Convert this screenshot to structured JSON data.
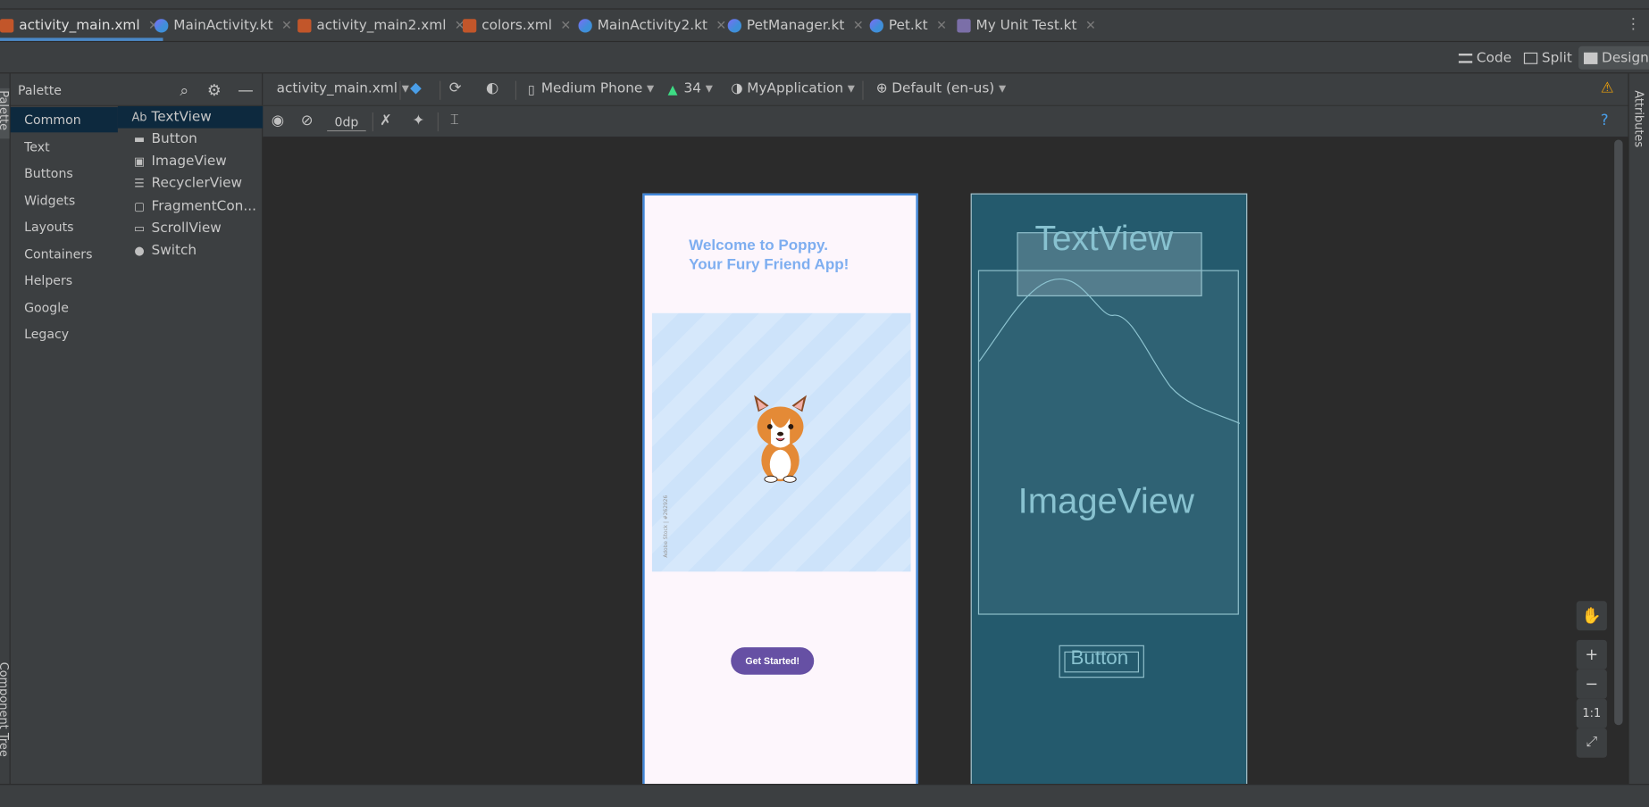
{
  "tabs": [
    {
      "label": "activity_main.xml",
      "type": "xml",
      "active": true
    },
    {
      "label": "MainActivity.kt",
      "type": "kt"
    },
    {
      "label": "activity_main2.xml",
      "type": "xml"
    },
    {
      "label": "colors.xml",
      "type": "xml"
    },
    {
      "label": "MainActivity2.kt",
      "type": "kt"
    },
    {
      "label": "PetManager.kt",
      "type": "kt"
    },
    {
      "label": "Pet.kt",
      "type": "kt"
    },
    {
      "label": "My Unit Test.kt",
      "type": "test"
    }
  ],
  "view_modes": {
    "code": "Code",
    "split": "Split",
    "design": "Design"
  },
  "palette": {
    "title": "Palette",
    "categories": [
      "Common",
      "Text",
      "Buttons",
      "Widgets",
      "Layouts",
      "Containers",
      "Helpers",
      "Google",
      "Legacy"
    ],
    "widgets": [
      {
        "label": "TextView",
        "icon": "Ab"
      },
      {
        "label": "Button",
        "icon": "▬"
      },
      {
        "label": "ImageView",
        "icon": "▣"
      },
      {
        "label": "RecyclerView",
        "icon": "☰"
      },
      {
        "label": "FragmentCon...",
        "icon": "▢"
      },
      {
        "label": "ScrollView",
        "icon": "▭"
      },
      {
        "label": "Switch",
        "icon": "●"
      }
    ]
  },
  "toolbar": {
    "file": "activity_main.xml",
    "device": "Medium Phone",
    "api": "34",
    "theme": "MyApplication",
    "locale": "Default (en-us)",
    "margin": "0dp"
  },
  "side_labels": {
    "palette": "Palette",
    "component_tree": "Component Tree",
    "attributes": "Attributes"
  },
  "design": {
    "welcome_text": "Welcome to Poppy.\nYour Fury Friend App!",
    "image_credit": "Adobe Stock | #262926",
    "button_label": "Get Started!"
  },
  "blueprint": {
    "textview": "TextView",
    "imageview": "ImageView",
    "button": "Button"
  },
  "zoom": {
    "zoom_in": "+",
    "zoom_out": "−",
    "actual_size": "1:1"
  },
  "colors": {
    "accent": "#4a88c7",
    "button": "#6650a4",
    "welcome": "#7eaef0",
    "blueprint": "#245a6d"
  }
}
